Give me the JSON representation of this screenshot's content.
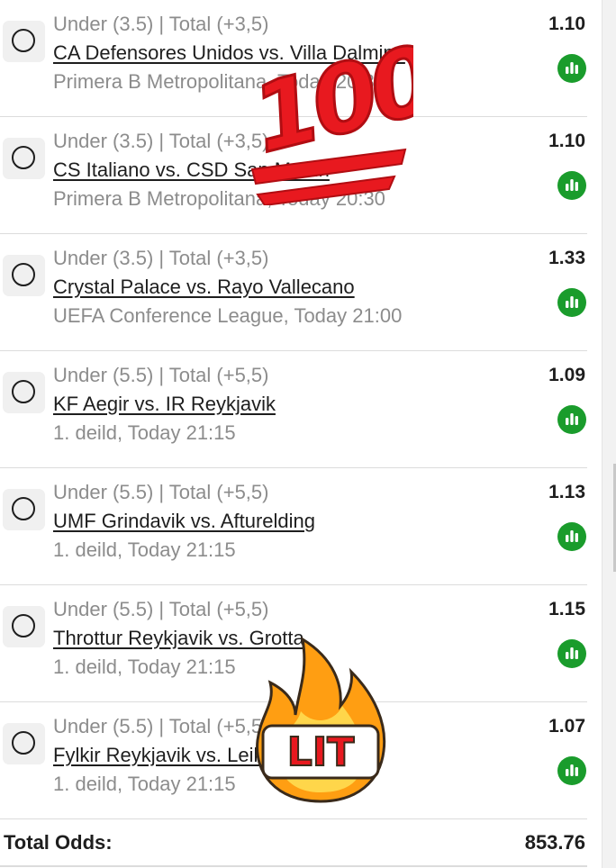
{
  "bets": [
    {
      "market": "Under (3.5) | Total (+3,5)",
      "match": "CA Defensores Unidos vs. Villa Dalmine",
      "league": "Primera B Metropolitana, Today 20:30",
      "odds": "1.10"
    },
    {
      "market": "Under (3.5) | Total (+3,5)",
      "match": "CS Italiano vs. CSD San Martin",
      "league": "Primera B Metropolitana, Today 20:30",
      "odds": "1.10"
    },
    {
      "market": "Under (3.5) | Total (+3,5)",
      "match": "Crystal Palace vs. Rayo Vallecano",
      "league": "UEFA Conference League, Today 21:00",
      "odds": "1.33"
    },
    {
      "market": "Under (5.5) | Total (+5,5)",
      "match": "KF Aegir vs. IR Reykjavik",
      "league": "1. deild, Today 21:15",
      "odds": "1.09"
    },
    {
      "market": "Under (5.5) | Total (+5,5)",
      "match": "UMF Grindavik vs. Afturelding",
      "league": "1. deild, Today 21:15",
      "odds": "1.13"
    },
    {
      "market": "Under (5.5) | Total (+5,5)",
      "match": "Throttur Reykjavik vs. Grotta",
      "league": "1. deild, Today 21:15",
      "odds": "1.15"
    },
    {
      "market": "Under (5.5) | Total (+5,5)",
      "match": "Fylkir Reykjavik vs. Leiknir Reykjavik",
      "league": "1. deild, Today 21:15",
      "odds": "1.07"
    }
  ],
  "total": {
    "label": "Total Odds:",
    "value": "853.76"
  },
  "stickers": {
    "hundred_text": "100",
    "lit_text": "LIT"
  },
  "icons": {
    "stats": "bar-chart-icon",
    "radio": "radio-unchecked-icon"
  },
  "colors": {
    "stats_green": "#1a9c2c",
    "sticker_red": "#e8191f",
    "fire_orange": "#ff9e12",
    "fire_yellow": "#ffd64a"
  }
}
